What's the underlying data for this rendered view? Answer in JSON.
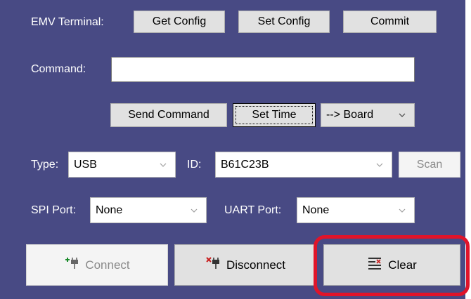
{
  "emv": {
    "label": "EMV Terminal:",
    "get_config": "Get Config",
    "set_config": "Set Config",
    "commit": "Commit"
  },
  "command": {
    "label": "Command:",
    "value": ""
  },
  "actions": {
    "send_command": "Send Command",
    "set_time": "Set Time",
    "target": "--> Board"
  },
  "connection": {
    "type_label": "Type:",
    "type_value": "USB",
    "id_label": "ID:",
    "id_value": "B61C23B",
    "scan": "Scan"
  },
  "ports": {
    "spi_label": "SPI Port:",
    "spi_value": "None",
    "uart_label": "UART Port:",
    "uart_value": "None"
  },
  "bottom": {
    "connect": "Connect",
    "disconnect": "Disconnect",
    "clear": "Clear"
  },
  "icons": {
    "connect": "plug-add-icon",
    "disconnect": "plug-remove-icon",
    "clear": "clear-list-icon",
    "dropdown": "chevron-down-icon"
  },
  "colors": {
    "panel": "#484a84",
    "highlight": "#e0142a",
    "connect_plus": "#1a8a2a",
    "disconnect_x": "#c81e1e"
  }
}
